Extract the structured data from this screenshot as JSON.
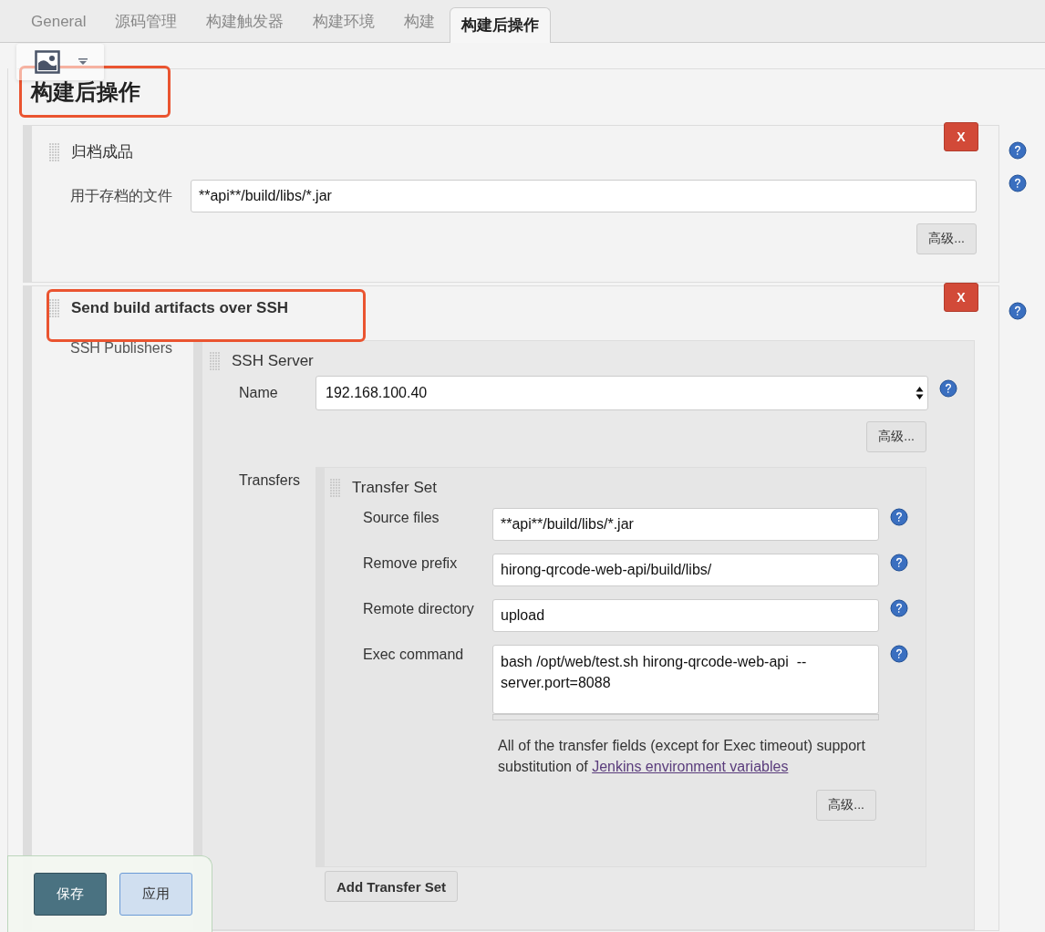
{
  "tabs": [
    {
      "label": "General",
      "selected": false
    },
    {
      "label": "源码管理",
      "selected": false
    },
    {
      "label": "构建触发器",
      "selected": false
    },
    {
      "label": "构建环境",
      "selected": false
    },
    {
      "label": "构建",
      "selected": false
    },
    {
      "label": "构建后操作",
      "selected": true
    }
  ],
  "section_title": "构建后操作",
  "section_title_highlighted": true,
  "steps": [
    {
      "kind": "archive",
      "title": "归档成品",
      "highlighted": false,
      "delete_label": "X",
      "field": {
        "label": "用于存档的文件",
        "value": "**api**/build/libs/*.jar"
      },
      "advanced_button": "高级..."
    },
    {
      "kind": "ssh",
      "title": "Send build artifacts over SSH",
      "highlighted": true,
      "delete_label": "X",
      "publishers_label": "SSH Publishers",
      "server": {
        "title": "SSH Server",
        "name_label": "Name",
        "name_value": "192.168.100.40",
        "advanced_button": "高级...",
        "transfers_label": "Transfers",
        "transfer_set": {
          "title": "Transfer Set",
          "fields": [
            {
              "kind": "input",
              "label": "Source files",
              "value": "**api**/build/libs/*.jar"
            },
            {
              "kind": "input",
              "label": "Remove prefix",
              "value": "hirong-qrcode-web-api/build/libs/"
            },
            {
              "kind": "input",
              "label": "Remote directory",
              "value": "upload"
            },
            {
              "kind": "textarea",
              "label": "Exec command",
              "value": "bash /opt/web/test.sh hirong-qrcode-web-api  --server.port=8088"
            }
          ],
          "note": "All of the transfer fields (except for Exec timeout) support substitution of",
          "note_link": "Jenkins environment variables",
          "advanced_button": "高级..."
        },
        "add_button": "Add Transfer Set"
      }
    }
  ],
  "footer_buttons": [
    {
      "kind": "primary",
      "label": "保存"
    },
    {
      "kind": "secondary",
      "label": "应用"
    }
  ]
}
